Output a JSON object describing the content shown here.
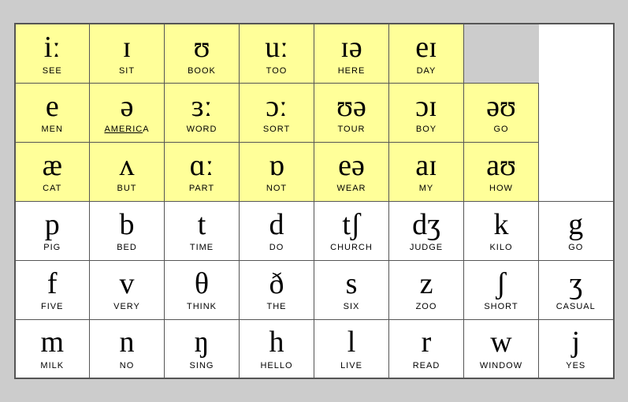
{
  "rows": [
    {
      "bg": "yellow",
      "cells": [
        {
          "sym": "iː",
          "word": "SEE"
        },
        {
          "sym": "ɪ",
          "word": "SIT"
        },
        {
          "sym": "ʊ",
          "word": "BOOK"
        },
        {
          "sym": "uː",
          "word": "TOO"
        },
        {
          "sym": "ɪə",
          "word": "HERE"
        },
        {
          "sym": "eɪ",
          "word": "DAY"
        },
        {
          "sym": "",
          "word": ""
        }
      ]
    },
    {
      "bg": "yellow",
      "cells": [
        {
          "sym": "e",
          "word": "MEN"
        },
        {
          "sym": "ə",
          "word": "AMERICA",
          "underline": "AMERIC"
        },
        {
          "sym": "ɜː",
          "word": "WORD"
        },
        {
          "sym": "ɔː",
          "word": "SORT"
        },
        {
          "sym": "ʊə",
          "word": "TOUR"
        },
        {
          "sym": "ɔɪ",
          "word": "BOY"
        },
        {
          "sym": "əʊ",
          "word": "GO"
        }
      ]
    },
    {
      "bg": "yellow",
      "cells": [
        {
          "sym": "æ",
          "word": "CAT"
        },
        {
          "sym": "ʌ",
          "word": "BUT"
        },
        {
          "sym": "ɑː",
          "word": "PART"
        },
        {
          "sym": "ɒ",
          "word": "NOT"
        },
        {
          "sym": "eə",
          "word": "WEAR"
        },
        {
          "sym": "aɪ",
          "word": "MY"
        },
        {
          "sym": "aʊ",
          "word": "HOW"
        }
      ]
    },
    {
      "bg": "white",
      "cells": [
        {
          "sym": "p",
          "word": "PIG"
        },
        {
          "sym": "b",
          "word": "BED"
        },
        {
          "sym": "t",
          "word": "TIME"
        },
        {
          "sym": "d",
          "word": "DO"
        },
        {
          "sym": "tʃ",
          "word": "CHURCH"
        },
        {
          "sym": "dʒ",
          "word": "JUDGE"
        },
        {
          "sym": "k",
          "word": "KILO"
        },
        {
          "sym": "g",
          "word": "GO"
        }
      ]
    },
    {
      "bg": "white",
      "cells": [
        {
          "sym": "f",
          "word": "FIVE"
        },
        {
          "sym": "v",
          "word": "VERY"
        },
        {
          "sym": "θ",
          "word": "THINK"
        },
        {
          "sym": "ð",
          "word": "THE"
        },
        {
          "sym": "s",
          "word": "SIX"
        },
        {
          "sym": "z",
          "word": "ZOO"
        },
        {
          "sym": "ʃ",
          "word": "SHORT"
        },
        {
          "sym": "ʒ",
          "word": "CASUAL"
        }
      ]
    },
    {
      "bg": "white",
      "cells": [
        {
          "sym": "m",
          "word": "MILK"
        },
        {
          "sym": "n",
          "word": "NO"
        },
        {
          "sym": "ŋ",
          "word": "SING"
        },
        {
          "sym": "h",
          "word": "HELLO"
        },
        {
          "sym": "l",
          "word": "LIVE"
        },
        {
          "sym": "r",
          "word": "READ"
        },
        {
          "sym": "w",
          "word": "WINDOW"
        },
        {
          "sym": "j",
          "word": "YES"
        }
      ]
    }
  ]
}
